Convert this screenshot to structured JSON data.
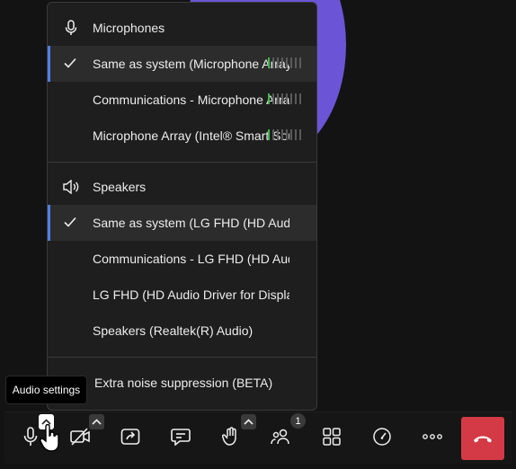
{
  "microphones": {
    "title": "Microphones",
    "items": [
      {
        "label": "Same as system (Microphone Array (Intel® Smart Sound Technology for Digital Microphones))",
        "selected": true,
        "level": 0.125
      },
      {
        "label": "Communications - Microphone Array (Intel® Smart Sound Technology for Digital Microphones)",
        "selected": false,
        "level": 0.125
      },
      {
        "label": "Microphone Array (Intel® Smart Sound Technology for Digital Microphones)",
        "selected": false,
        "level": 0.125
      }
    ]
  },
  "speakers": {
    "title": "Speakers",
    "items": [
      {
        "label": "Same as system (LG FHD (HD Audio Driver for Display Audio))",
        "selected": true
      },
      {
        "label": "Communications - LG FHD (HD Audio Driver for Display Audio)",
        "selected": false
      },
      {
        "label": "LG FHD (HD Audio Driver for Display Audio)",
        "selected": false
      },
      {
        "label": "Speakers (Realtek(R) Audio)",
        "selected": false
      }
    ]
  },
  "noise_suppression": {
    "label": "Extra noise suppression (BETA)"
  },
  "tooltip": {
    "text": "Audio settings"
  },
  "toolbar": {
    "participants_count": "1"
  },
  "colors": {
    "accent": "#4f7ee8",
    "meter_active": "#3fb950",
    "end_call": "#d43a45",
    "avatar": "#6b55d6"
  },
  "icons": [
    "microphone-icon",
    "speaker-icon",
    "checkmark-icon",
    "chevron-up-icon",
    "camera-off-icon",
    "share-screen-icon",
    "chat-icon",
    "hand-icon",
    "participants-icon",
    "grid-icon",
    "speedometer-icon",
    "more-horizontal-icon",
    "hang-up-icon"
  ]
}
